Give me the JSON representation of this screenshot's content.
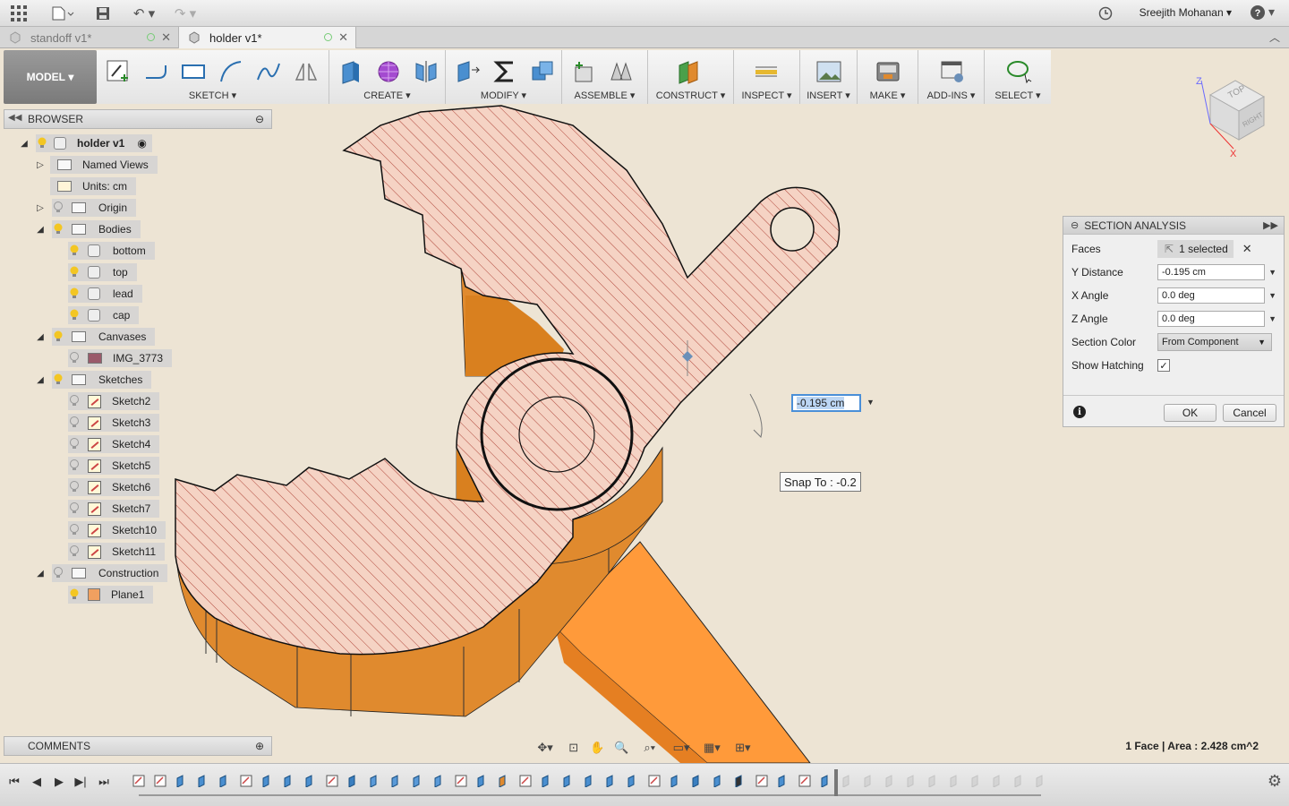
{
  "user": {
    "name": "Sreejith Mohanan"
  },
  "tabs": [
    {
      "label": "standoff v1*",
      "active": false
    },
    {
      "label": "holder v1*",
      "active": true
    }
  ],
  "toolbar": {
    "workspace": "MODEL",
    "groups": [
      {
        "label": "SKETCH"
      },
      {
        "label": "CREATE"
      },
      {
        "label": "MODIFY"
      },
      {
        "label": "ASSEMBLE"
      },
      {
        "label": "CONSTRUCT"
      },
      {
        "label": "INSPECT"
      },
      {
        "label": "INSERT"
      },
      {
        "label": "MAKE"
      },
      {
        "label": "ADD-INS"
      },
      {
        "label": "SELECT"
      }
    ]
  },
  "viewcube": {
    "top": "TOP",
    "right": "RIGHT",
    "axis_x": "X",
    "axis_z": "Z"
  },
  "browser": {
    "title": "BROWSER",
    "items": [
      {
        "label": "holder v1"
      },
      {
        "label": "Named Views"
      },
      {
        "label": "Units: cm"
      },
      {
        "label": "Origin"
      },
      {
        "label": "Bodies"
      },
      {
        "label": "bottom"
      },
      {
        "label": "top"
      },
      {
        "label": "lead"
      },
      {
        "label": "cap"
      },
      {
        "label": "Canvases"
      },
      {
        "label": "IMG_3773"
      },
      {
        "label": "Sketches"
      },
      {
        "label": "Sketch2"
      },
      {
        "label": "Sketch3"
      },
      {
        "label": "Sketch4"
      },
      {
        "label": "Sketch5"
      },
      {
        "label": "Sketch6"
      },
      {
        "label": "Sketch7"
      },
      {
        "label": "Sketch10"
      },
      {
        "label": "Sketch11"
      },
      {
        "label": "Construction"
      },
      {
        "label": "Plane1"
      }
    ]
  },
  "comments": {
    "title": "COMMENTS"
  },
  "section_analysis": {
    "title": "SECTION ANALYSIS",
    "faces_label": "Faces",
    "faces_value": "1 selected",
    "y_distance_label": "Y Distance",
    "y_distance_value": "-0.195 cm",
    "x_angle_label": "X Angle",
    "x_angle_value": "0.0 deg",
    "z_angle_label": "Z Angle",
    "z_angle_value": "0.0 deg",
    "section_color_label": "Section Color",
    "section_color_value": "From Component",
    "show_hatching_label": "Show Hatching",
    "show_hatching": true,
    "ok": "OK",
    "cancel": "Cancel"
  },
  "canvas": {
    "distance_input": "-0.195 cm",
    "snap_tooltip": "Snap To : -0.2",
    "colors": {
      "body": "#e08a2e",
      "section": "#f5d3c4",
      "hatch": "#b0463a",
      "lever": "#ff9a3a"
    }
  },
  "status": {
    "text": "1 Face | Area : 2.428 cm^2"
  }
}
